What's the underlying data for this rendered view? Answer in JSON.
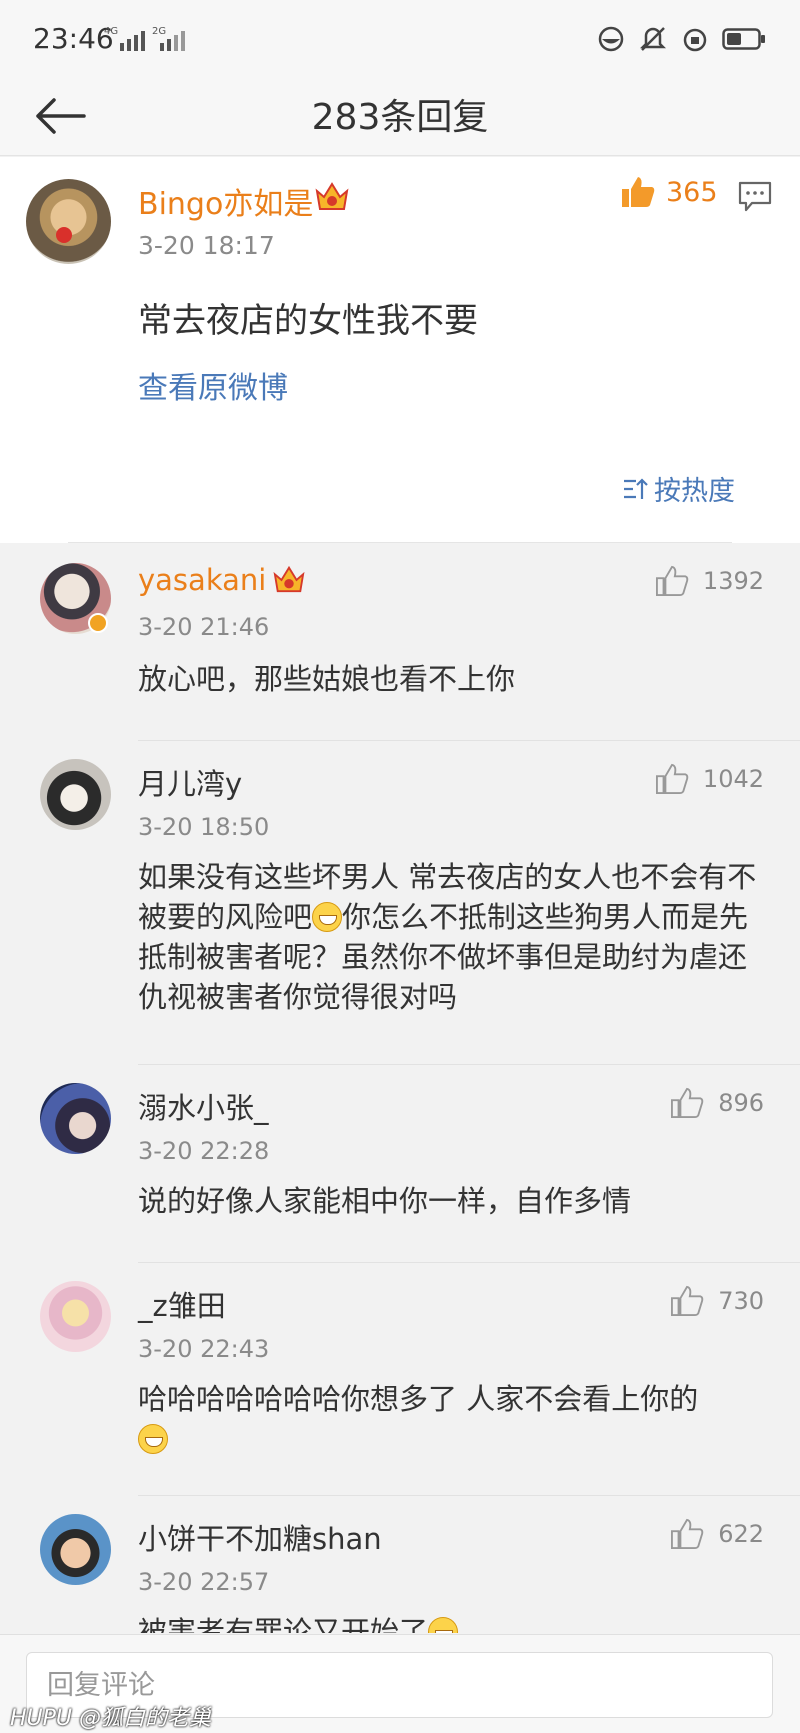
{
  "status_bar": {
    "time": "23:46",
    "net1": "4G",
    "net2": "2G"
  },
  "header": {
    "title": "283条回复"
  },
  "main_post": {
    "name": "Bingo亦如是",
    "time": "3-20 18:17",
    "likes": "365",
    "text": "常去夜店的女性我不要",
    "view_original": "查看原微博",
    "sort_label": "按热度"
  },
  "replies": [
    {
      "name": "yasakani",
      "time": "3-20 21:46",
      "likes": "1392",
      "text": "放心吧，那些姑娘也看不上你"
    },
    {
      "name": "月儿湾y",
      "time": "3-20 18:50",
      "likes": "1042",
      "text_a": "如果没有这些坏男人 常去夜店的女人也不会有不被要的风险吧",
      "text_b": "你怎么不抵制这些狗男人而是先抵制被害者呢？虽然你不做坏事但是助纣为虐还仇视被害者你觉得很对吗"
    },
    {
      "name": "溺水小张_",
      "time": "3-20 22:28",
      "likes": "896",
      "text": "说的好像人家能相中你一样，自作多情"
    },
    {
      "name": "_z雏田",
      "time": "3-20 22:43",
      "likes": "730",
      "text": "哈哈哈哈哈哈哈你想多了 人家不会看上你的"
    },
    {
      "name": "小饼干不加糖shan",
      "time": "3-20 22:57",
      "likes": "622",
      "text": "被害者有罪论又开始了"
    }
  ],
  "reply_box": {
    "placeholder": "回复评论"
  },
  "watermark": "HUPU @狐白的老巢",
  "colors": {
    "vip_name": "#ea7f1a",
    "link": "#4a79b8",
    "background": "#f2f2f2"
  }
}
